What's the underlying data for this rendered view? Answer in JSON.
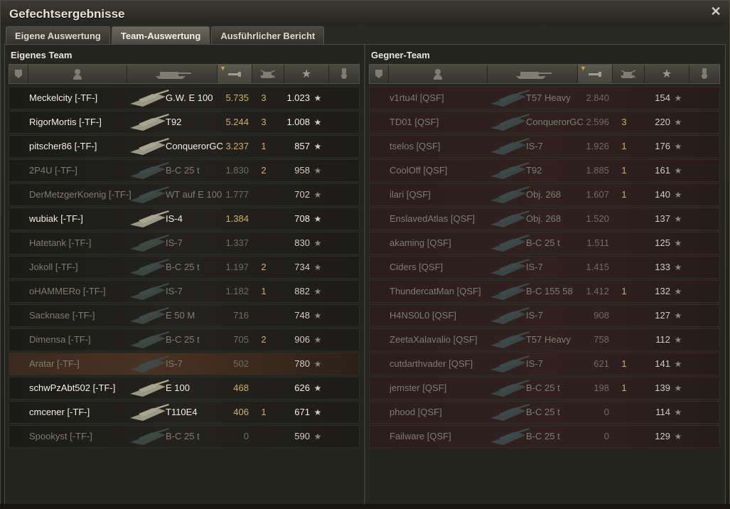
{
  "window": {
    "title": "Gefechtsergebnisse"
  },
  "tabs": [
    {
      "label": "Eigene Auswertung",
      "active": false
    },
    {
      "label": "Team-Auswertung",
      "active": true
    },
    {
      "label": "Ausführlicher Bericht",
      "active": false
    }
  ],
  "own_team": {
    "title": "Eigenes Team",
    "rows": [
      {
        "name": "Meckelcity [-TF-]",
        "tank": "G.W. E 100",
        "damage": "5.735",
        "kills": "3",
        "xp": "1.023",
        "alive": true,
        "highlight": false
      },
      {
        "name": "RigorMortis [-TF-]",
        "tank": "T92",
        "damage": "5.244",
        "kills": "3",
        "xp": "1.008",
        "alive": true,
        "highlight": false
      },
      {
        "name": "pitscher86 [-TF-]",
        "tank": "ConquerorGC",
        "damage": "3.237",
        "kills": "1",
        "xp": "857",
        "alive": true,
        "highlight": false
      },
      {
        "name": "2P4U [-TF-]",
        "tank": "B-C 25 t",
        "damage": "1.830",
        "kills": "2",
        "xp": "958",
        "alive": false,
        "highlight": false
      },
      {
        "name": "DerMetzgerKoenig [-TF-]",
        "tank": "WT auf E 100",
        "damage": "1.777",
        "kills": "",
        "xp": "702",
        "alive": false,
        "highlight": false
      },
      {
        "name": "wubiak [-TF-]",
        "tank": "IS-4",
        "damage": "1.384",
        "kills": "",
        "xp": "708",
        "alive": true,
        "highlight": false
      },
      {
        "name": "Hatetank [-TF-]",
        "tank": "IS-7",
        "damage": "1.337",
        "kills": "",
        "xp": "830",
        "alive": false,
        "highlight": false
      },
      {
        "name": "Jokoll [-TF-]",
        "tank": "B-C 25 t",
        "damage": "1.197",
        "kills": "2",
        "xp": "734",
        "alive": false,
        "highlight": false
      },
      {
        "name": "oHAMMERo [-TF-]",
        "tank": "IS-7",
        "damage": "1.182",
        "kills": "1",
        "xp": "882",
        "alive": false,
        "highlight": false
      },
      {
        "name": "Sacknase [-TF-]",
        "tank": "E 50 M",
        "damage": "716",
        "kills": "",
        "xp": "748",
        "alive": false,
        "highlight": false
      },
      {
        "name": "Dimensa [-TF-]",
        "tank": "B-C 25 t",
        "damage": "705",
        "kills": "2",
        "xp": "906",
        "alive": false,
        "highlight": false
      },
      {
        "name": "Aratar [-TF-]",
        "tank": "IS-7",
        "damage": "502",
        "kills": "",
        "xp": "780",
        "alive": false,
        "highlight": true
      },
      {
        "name": "schwPzAbt502 [-TF-]",
        "tank": "E 100",
        "damage": "468",
        "kills": "",
        "xp": "626",
        "alive": true,
        "highlight": false
      },
      {
        "name": "cmcener [-TF-]",
        "tank": "T110E4",
        "damage": "406",
        "kills": "1",
        "xp": "671",
        "alive": true,
        "highlight": false
      },
      {
        "name": "Spookyst [-TF-]",
        "tank": "B-C 25 t",
        "damage": "0",
        "kills": "",
        "xp": "590",
        "alive": false,
        "highlight": false
      }
    ]
  },
  "enemy_team": {
    "title": "Gegner-Team",
    "rows": [
      {
        "name": "v1rtu4l [QSF]",
        "tank": "T57 Heavy",
        "damage": "2.840",
        "kills": "",
        "xp": "154",
        "alive": false,
        "highlight": false
      },
      {
        "name": "TD01 [QSF]",
        "tank": "ConquerorGC",
        "damage": "2.596",
        "kills": "3",
        "xp": "220",
        "alive": false,
        "highlight": false
      },
      {
        "name": "tselos [QSF]",
        "tank": "IS-7",
        "damage": "1.926",
        "kills": "1",
        "xp": "176",
        "alive": false,
        "highlight": false
      },
      {
        "name": "CoolOff [QSF]",
        "tank": "T92",
        "damage": "1.885",
        "kills": "1",
        "xp": "161",
        "alive": false,
        "highlight": false
      },
      {
        "name": "ilari [QSF]",
        "tank": "Obj. 268",
        "damage": "1.607",
        "kills": "1",
        "xp": "140",
        "alive": false,
        "highlight": false
      },
      {
        "name": "EnslavedAtlas [QSF]",
        "tank": "Obj. 268",
        "damage": "1.520",
        "kills": "",
        "xp": "137",
        "alive": false,
        "highlight": false
      },
      {
        "name": "akaming [QSF]",
        "tank": "B-C 25 t",
        "damage": "1.511",
        "kills": "",
        "xp": "125",
        "alive": false,
        "highlight": false
      },
      {
        "name": "Ciders [QSF]",
        "tank": "IS-7",
        "damage": "1.415",
        "kills": "",
        "xp": "133",
        "alive": false,
        "highlight": false
      },
      {
        "name": "ThundercatMan [QSF]",
        "tank": "B-C 155 58",
        "damage": "1.412",
        "kills": "1",
        "xp": "132",
        "alive": false,
        "highlight": false
      },
      {
        "name": "H4NS0L0 [QSF]",
        "tank": "IS-7",
        "damage": "908",
        "kills": "",
        "xp": "127",
        "alive": false,
        "highlight": false
      },
      {
        "name": "ZeetaXalavalio [QSF]",
        "tank": "T57 Heavy",
        "damage": "758",
        "kills": "",
        "xp": "112",
        "alive": false,
        "highlight": false
      },
      {
        "name": "cutdarthvader [QSF]",
        "tank": "IS-7",
        "damage": "621",
        "kills": "1",
        "xp": "141",
        "alive": false,
        "highlight": false
      },
      {
        "name": "jemster [QSF]",
        "tank": "B-C 25 t",
        "damage": "198",
        "kills": "1",
        "xp": "139",
        "alive": false,
        "highlight": false
      },
      {
        "name": "phood [QSF]",
        "tank": "B-C 25 t",
        "damage": "0",
        "kills": "",
        "xp": "114",
        "alive": false,
        "highlight": false
      },
      {
        "name": "Failware [QSF]",
        "tank": "B-C 25 t",
        "damage": "0",
        "kills": "",
        "xp": "129",
        "alive": false,
        "highlight": false
      }
    ]
  },
  "icons": {
    "rank": "squad-shield-icon",
    "player": "player-silhouette-icon",
    "tank": "tank-silhouette-icon",
    "damage": "damage-shell-icon",
    "kills": "destroyed-tank-icon",
    "xp": "star-icon",
    "medal": "medal-icon",
    "close": "close-icon"
  },
  "colors": {
    "accent_gold": "#d1ae62",
    "alive_text": "#f2f0e2",
    "dead_text": "#7f7c70",
    "enemy_row": "#30211f",
    "own_row": "#23221e"
  }
}
